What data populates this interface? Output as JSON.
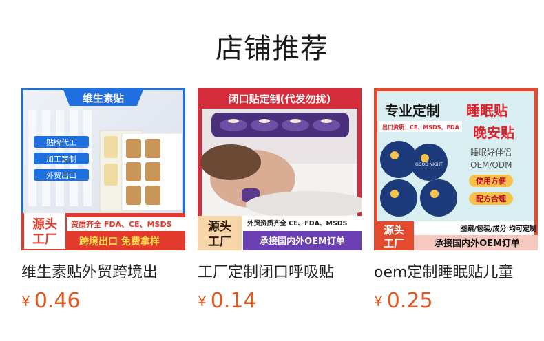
{
  "section": {
    "title": "店铺推荐"
  },
  "products": [
    {
      "name": "维生素贴外贸跨境出",
      "currency": "¥",
      "price": "0.46",
      "image": {
        "banner": "维生素贴",
        "tags": [
          "贴牌代工",
          "加工定制",
          "外贸出口"
        ],
        "badge": [
          "源头",
          "工厂"
        ],
        "cert": "资质齐全 FDA、CE、MSDS",
        "slogan": "跨境出口  免费拿样"
      }
    },
    {
      "name": "工厂定制闭口呼吸贴",
      "currency": "¥",
      "price": "0.14",
      "image": {
        "banner": "闭口贴定制(代发勿扰)",
        "badge": [
          "源头",
          "工厂"
        ],
        "cert": "外贸资质齐全 CE、FDA、MSDS",
        "slogan": "承接国内外OEM订单"
      }
    },
    {
      "name": "oem定制睡眠贴儿童",
      "currency": "¥",
      "price": "0.25",
      "image": {
        "headline_a": "专业定制",
        "headline_b": "睡眠贴",
        "headline_c": "晚安贴",
        "cert": "出口资质：CE、MSDS、FDA",
        "sub1": "睡眠好伴侣",
        "sub2": "OEM/ODM",
        "pill1": "使用方便",
        "pill2": "配方合理",
        "sticker_text": "GOOD NIGHT",
        "note": "图案/包装/成分 均可定制",
        "badge": [
          "源头",
          "工厂"
        ],
        "slogan": "承接国内外OEM订单"
      }
    }
  ],
  "colors": {
    "price": "#e4571f",
    "title": "#1a1a1a"
  }
}
